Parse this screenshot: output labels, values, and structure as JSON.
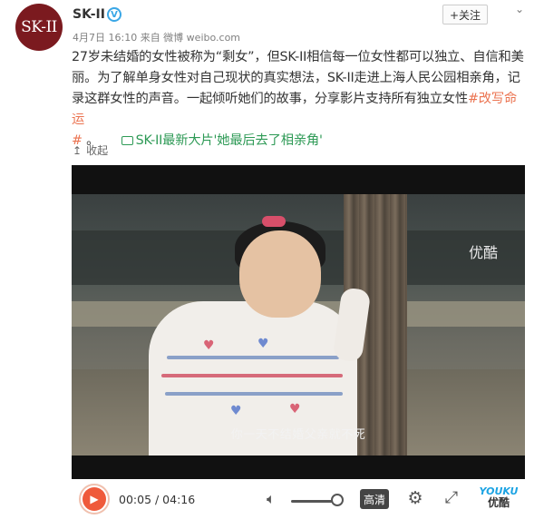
{
  "post": {
    "avatar_text": "SK-II",
    "user_name": "SK-II",
    "verified_mark": "V",
    "meta": "4月7日 16:10 来自 微博 weibo.com",
    "follow_label": "+关注",
    "body_lines": [
      "27岁未结婚的女性被称为“剩女”，但SK-II相信每一位女性都可以独立、自信和美",
      "丽。为了解单身女性对自己现状的真实想法，SK-II走进上海人民公园相亲角，记",
      "录这群女性的声音。一起倾听她们的故事，分享影片支持所有独立女性"
    ],
    "hashtag_part1": "#改写命运",
    "hashtag_part2": "#",
    "after_hashtag": " 。 ",
    "video_link": "SK-II最新大片'她最后去了相亲角'",
    "collapse_label": "收起"
  },
  "video": {
    "subtitle": "你一天不结婚父亲就不死",
    "top_watermark": "优酷",
    "time": "00:05 / 04:16",
    "quality_label": "高清",
    "brand_en": "YOUKU",
    "brand_zh": "优酷",
    "progress_fraction": 0.02
  },
  "colors": {
    "accent_orange": "#eb7350",
    "link_green": "#2e9a56",
    "play_red": "#ef5a3b",
    "youku_blue": "#1ba3e3"
  },
  "icons": [
    "chevron-down-icon",
    "verified-icon",
    "collapse-arrow-icon",
    "link-icon",
    "play-icon",
    "volume-icon",
    "gear-icon",
    "fullscreen-icon"
  ]
}
